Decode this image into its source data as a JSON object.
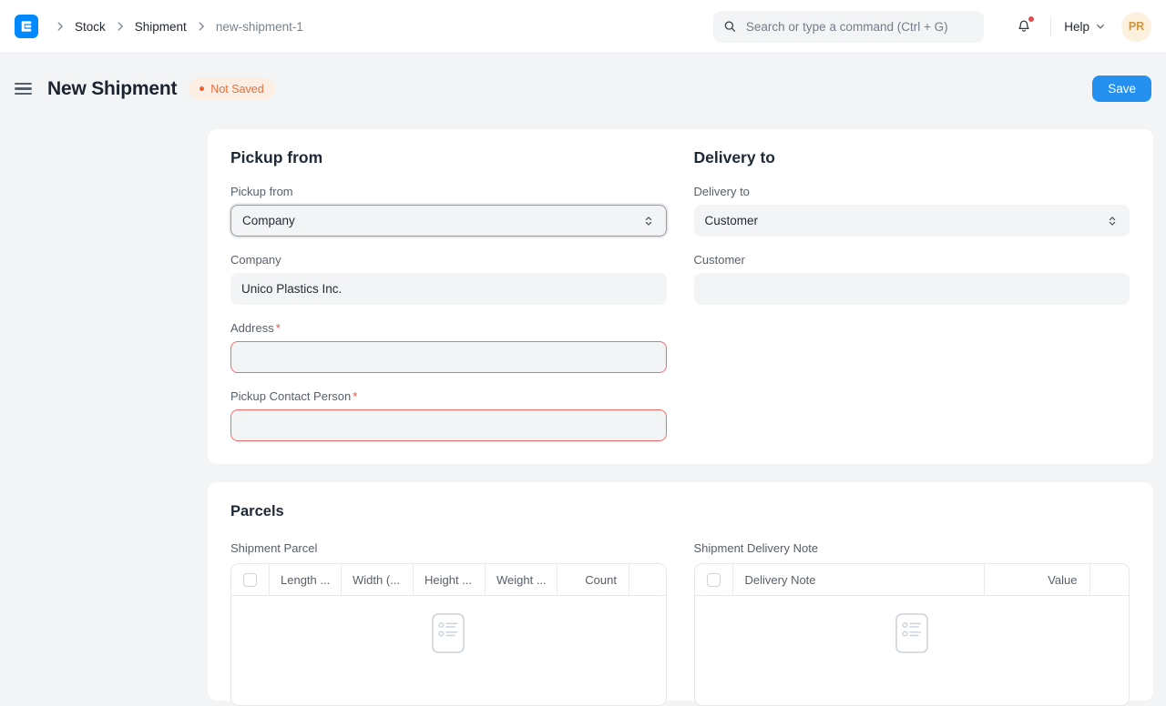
{
  "colors": {
    "accent_blue": "#2490ef",
    "logo_blue": "#0089ff",
    "error_border_red": "#f66a6a",
    "required_asterisk_red": "#f0503c",
    "status_text_orange": "#ee6d39",
    "status_bg_peach": "#fdeee3",
    "notification_dot_red": "#e24c4c",
    "avatar_bg": "#fcf0de",
    "avatar_text": "#cf9642",
    "page_bg": "#f3f4f6"
  },
  "navbar": {
    "breadcrumbs": [
      {
        "label": "Stock"
      },
      {
        "label": "Shipment"
      },
      {
        "label": "new-shipment-1"
      }
    ],
    "search": {
      "placeholder": "Search or type a command (Ctrl + G)"
    },
    "help_label": "Help",
    "avatar_initials": "PR"
  },
  "page_header": {
    "title": "New Shipment",
    "status_badge": "Not Saved",
    "save_label": "Save"
  },
  "form": {
    "pickup": {
      "heading": "Pickup from",
      "pickup_from_label": "Pickup from",
      "pickup_from_value": "Company",
      "company_label": "Company",
      "company_value": "Unico Plastics Inc.",
      "address_label": "Address",
      "contact_label": "Pickup Contact Person",
      "required_marker": "*"
    },
    "delivery": {
      "heading": "Delivery to",
      "delivery_to_label": "Delivery to",
      "delivery_to_value": "Customer",
      "customer_label": "Customer",
      "customer_value": ""
    },
    "parcels": {
      "heading": "Parcels",
      "shipment_parcel": {
        "label": "Shipment Parcel",
        "columns": [
          "Length ...",
          "Width (...",
          "Height ...",
          "Weight ...",
          "Count"
        ]
      },
      "shipment_delivery_note": {
        "label": "Shipment Delivery Note",
        "columns": [
          "Delivery Note",
          "Value"
        ]
      }
    }
  }
}
